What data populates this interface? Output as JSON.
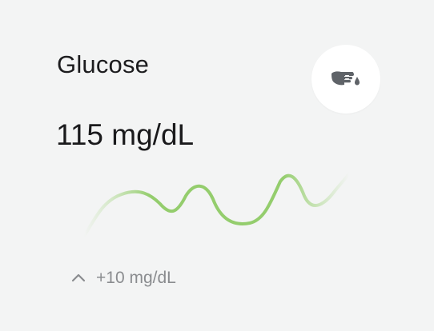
{
  "card": {
    "title": "Glucose",
    "value": "115 mg/dL",
    "icon": "glucose-meter-finger-icon",
    "delta": "+10 mg/dL",
    "trend_icon": "chevron-up-icon"
  },
  "colors": {
    "background": "#f3f4f4",
    "accent": "#9fd37a",
    "text_primary": "#1a1a1c",
    "text_secondary": "#8a8c8f"
  }
}
